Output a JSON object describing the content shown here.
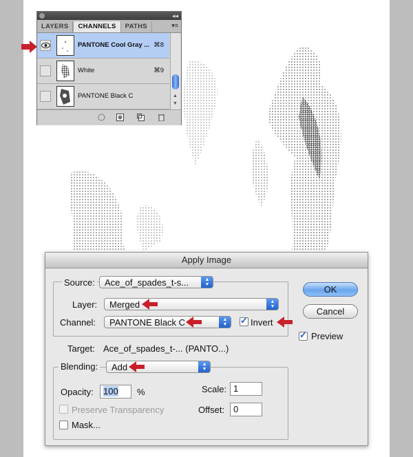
{
  "channels_panel": {
    "tabs": [
      {
        "label": "LAYERS",
        "active": false
      },
      {
        "label": "CHANNELS",
        "active": true
      },
      {
        "label": "PATHS",
        "active": false
      }
    ],
    "channels": [
      {
        "name": "PANTONE Cool Gray ...",
        "shortcut": "⌘8",
        "selected": true,
        "visible": true
      },
      {
        "name": "White",
        "shortcut": "⌘9",
        "selected": false,
        "visible": false
      },
      {
        "name": "PANTONE Black C",
        "shortcut": "",
        "selected": false,
        "visible": false
      }
    ],
    "bottom_icons": [
      "load-channel-selection-icon",
      "save-selection-icon",
      "new-channel-icon",
      "trash-icon"
    ]
  },
  "dialog": {
    "title": "Apply Image",
    "source_label": "Source:",
    "source_value": "Ace_of_spades_t-s...",
    "layer_label": "Layer:",
    "layer_value": "Merged",
    "channel_label": "Channel:",
    "channel_value": "PANTONE Black C",
    "invert_label": "Invert",
    "invert_checked": true,
    "target_label": "Target:",
    "target_value": "Ace_of_spades_t-... (PANTO...)",
    "blending_label": "Blending:",
    "blending_value": "Add",
    "opacity_label": "Opacity:",
    "opacity_value": "100",
    "opacity_unit": "%",
    "scale_label": "Scale:",
    "scale_value": "1",
    "offset_label": "Offset:",
    "offset_value": "0",
    "preserve_label": "Preserve Transparency",
    "preserve_enabled": false,
    "mask_label": "Mask...",
    "mask_checked": false,
    "ok_label": "OK",
    "cancel_label": "Cancel",
    "preview_label": "Preview",
    "preview_checked": true
  },
  "colors": {
    "accent_red": "#c8202a",
    "selection_blue": "#b3cdf5",
    "aqua_blue": "#1f5ec8"
  }
}
